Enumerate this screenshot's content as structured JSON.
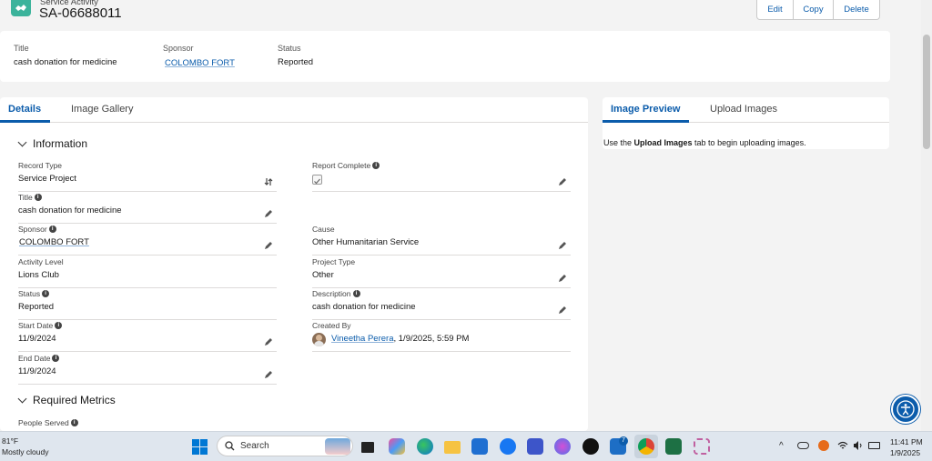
{
  "header": {
    "object_type": "Service Activity",
    "record_name": "SA-06688011",
    "actions": [
      "Edit",
      "Copy",
      "Delete"
    ]
  },
  "highlights": [
    {
      "label": "Title",
      "value": "cash donation for medicine",
      "link": false
    },
    {
      "label": "Sponsor",
      "value": "COLOMBO FORT",
      "link": true
    },
    {
      "label": "Status",
      "value": "Reported",
      "link": false
    }
  ],
  "left_tabs": {
    "active": "Details",
    "other": "Image Gallery"
  },
  "sections": {
    "information": "Information",
    "required_metrics": "Required Metrics"
  },
  "fields": {
    "record_type": {
      "label": "Record Type",
      "value": "Service Project"
    },
    "report_complete": {
      "label": "Report Complete",
      "checked": true
    },
    "title": {
      "label": "Title",
      "value": "cash donation for medicine"
    },
    "sponsor": {
      "label": "Sponsor",
      "value": "COLOMBO FORT"
    },
    "cause": {
      "label": "Cause",
      "value": "Other Humanitarian Service"
    },
    "activity_level": {
      "label": "Activity Level",
      "value": "Lions Club"
    },
    "project_type": {
      "label": "Project Type",
      "value": "Other"
    },
    "status": {
      "label": "Status",
      "value": "Reported"
    },
    "description": {
      "label": "Description",
      "value": "cash donation for medicine"
    },
    "start_date": {
      "label": "Start Date",
      "value": "11/9/2024"
    },
    "created_by": {
      "label": "Created By",
      "user": "Vineetha Perera",
      "date": ", 1/9/2025, 5:59 PM"
    },
    "end_date": {
      "label": "End Date",
      "value": "11/9/2024"
    },
    "people_served": {
      "label": "People Served"
    }
  },
  "right_panel": {
    "tabs": {
      "active": "Image Preview",
      "other": "Upload Images"
    },
    "message_prefix": "Use the ",
    "message_bold": "Upload Images",
    "message_suffix": " tab to begin uploading images."
  },
  "taskbar": {
    "weather_temp": "81°F",
    "weather_desc": "Mostly cloudy",
    "search_placeholder": "Search",
    "time": "11:41 PM",
    "date": "1/9/2025",
    "notification_count": "7"
  },
  "colors": {
    "brand": "#0b5cab",
    "object_icon": "#3bb39b",
    "card_bg": "#ffffff",
    "page_bg": "#f3f3f3"
  }
}
